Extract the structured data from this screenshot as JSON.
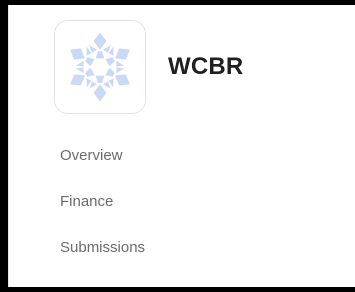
{
  "sidebar": {
    "brand": {
      "title": "WCBR",
      "logo_icon": "snowflake-icon",
      "logo_color": "#c9d9f7"
    },
    "items": [
      {
        "label": "Overview"
      },
      {
        "label": "Finance"
      },
      {
        "label": "Submissions"
      }
    ]
  }
}
